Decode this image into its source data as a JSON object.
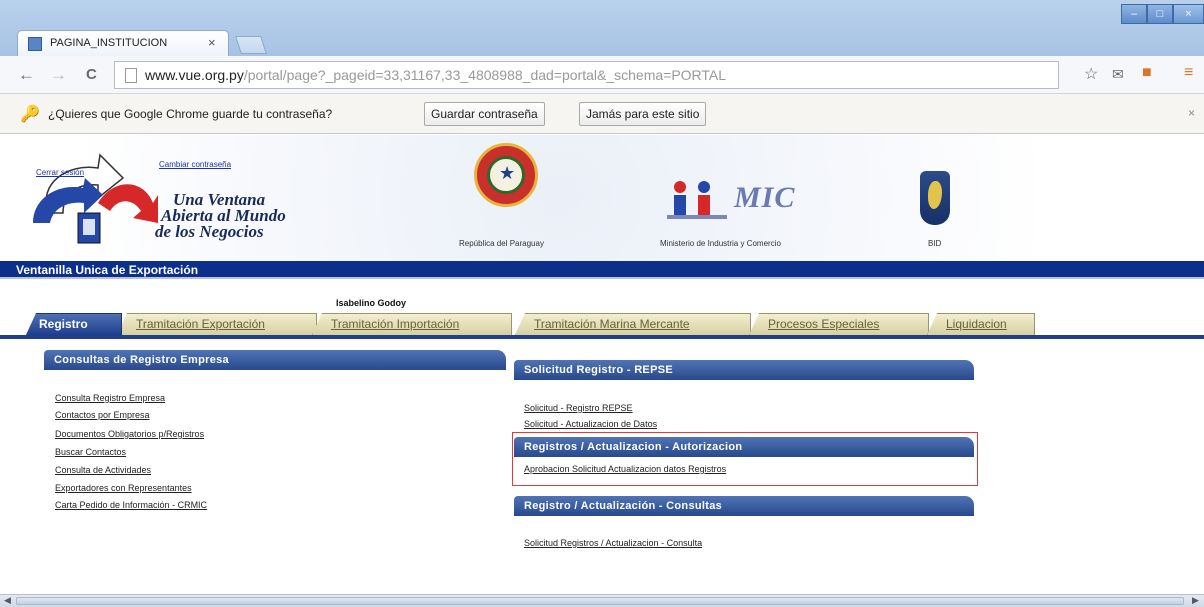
{
  "browser": {
    "tab_title": "PAGINA_INSTITUCION",
    "tab_close": "×",
    "url_host": "www.vue.org.py",
    "url_path": "/portal/page?_pageid=33,31167,33_4808988_dad=portal&_schema=PORTAL",
    "infobar": {
      "message": "¿Quieres que Google Chrome guarde tu contraseña?",
      "save_button": "Guardar contraseña",
      "never_button": "Jamás para este sitio",
      "close": "×"
    },
    "nav": {
      "back": "←",
      "forward": "→",
      "reload": "C"
    },
    "window": {
      "minimize": "–",
      "maximize": "□",
      "close": "×"
    }
  },
  "header": {
    "slogan_line1": "Una Ventana",
    "slogan_line2": "Abierta al Mundo",
    "slogan_line3": "de los Negocios",
    "caption_paraguay": "República del Paraguay",
    "mic_logo_text": "MIC",
    "caption_mic": "Ministerio de Industria y Comercio",
    "caption_bid": "BID",
    "site_title": "Ventanilla Unica de Exportación"
  },
  "user": {
    "logout": "Cerrar sesión",
    "change_password": "Cambiar contraseña",
    "name": "Isabelino Godoy"
  },
  "tabs": [
    "Registro",
    "Tramitación Exportación",
    "Tramitación Importación",
    "Tramitación Marina Mercante",
    "Procesos Especiales",
    "Liquidacion"
  ],
  "left_panel": {
    "title": "Consultas de Registro Empresa",
    "links": [
      "Consulta Registro Empresa",
      "Contactos por Empresa",
      "Documentos Obligatorios p/Registros",
      "Buscar Contactos",
      "Consulta de Actividades",
      "Exportadores con Representantes",
      "Carta Pedido de Información - CRMIC"
    ]
  },
  "right_panels": {
    "repse": {
      "title": "Solicitud Registro - REPSE",
      "links": [
        "Solicitud - Registro REPSE",
        "Solicitud - Actualizacion de Datos"
      ]
    },
    "autorizacion": {
      "title": "Registros / Actualizacion - Autorizacion",
      "links": [
        "Aprobacion Solicitud Actualizacion datos Registros"
      ]
    },
    "consultas": {
      "title": "Registro / Actualización - Consultas",
      "links": [
        "Solicitud Registros / Actualizacion - Consulta"
      ]
    }
  },
  "colors": {
    "accent_blue": "#0b2f8a",
    "panel_blue": "#28498c",
    "tab_inactive": "#d6d0a2",
    "highlight_red": "#e23b3b"
  }
}
